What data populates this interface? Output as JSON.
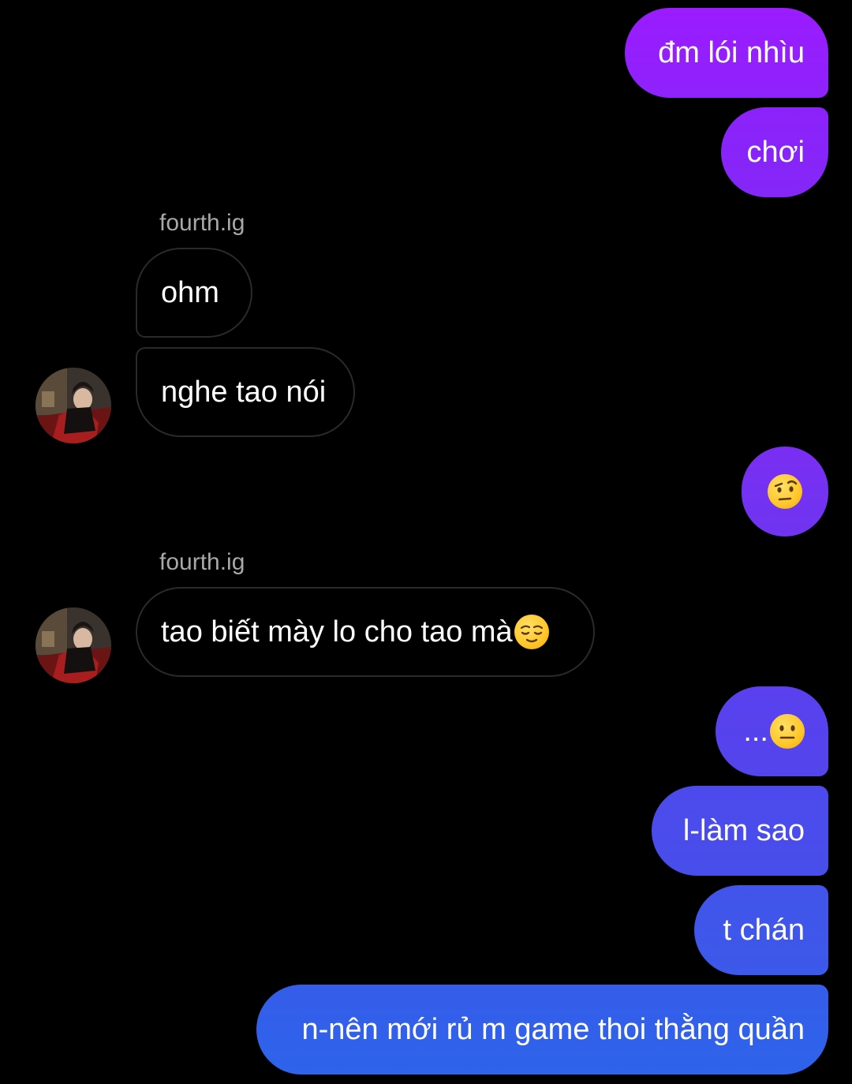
{
  "colors": {
    "background": "#000000",
    "incoming_border": "#2a2a2a",
    "sender_name": "#a8a8a8",
    "outgoing_top": "#9b1bff",
    "outgoing_bottom": "#2a62ea"
  },
  "messages": [
    {
      "dir": "out",
      "text": "đm lói nhìu"
    },
    {
      "dir": "out",
      "text": "chơi"
    },
    {
      "dir": "in",
      "sender": "fourth.ig",
      "text": "ohm"
    },
    {
      "dir": "in",
      "text": "nghe tao nói"
    },
    {
      "dir": "out",
      "emoji": "face-with-raised-eyebrow-emoji"
    },
    {
      "dir": "in",
      "sender": "fourth.ig",
      "text": "tao biết mày lo cho tao mà",
      "emoji": "relieved-face-emoji"
    },
    {
      "dir": "out",
      "text": "...",
      "emoji": "neutral-face-emoji"
    },
    {
      "dir": "out",
      "text": "l-làm sao"
    },
    {
      "dir": "out",
      "text": "t chán"
    },
    {
      "dir": "out",
      "text": "n-nên mới rủ m game thoi thằng quần"
    }
  ]
}
